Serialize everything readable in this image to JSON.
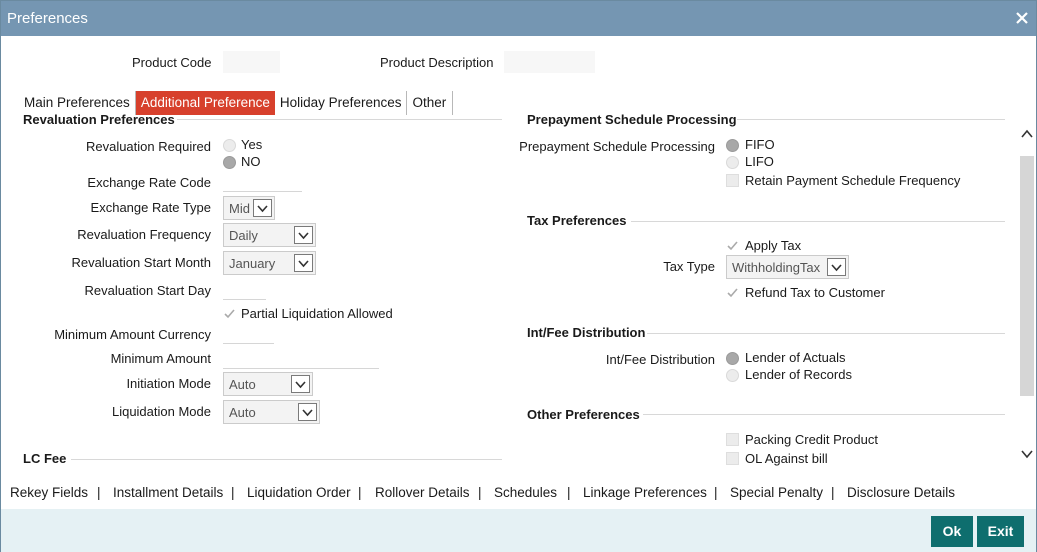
{
  "window": {
    "title": "Preferences"
  },
  "header": {
    "product_code_label": "Product Code",
    "product_code_value": "",
    "product_description_label": "Product Description",
    "product_description_value": ""
  },
  "tabs": [
    {
      "label": "Main Preferences"
    },
    {
      "label": "Additional Preference",
      "active": true
    },
    {
      "label": "Holiday Preferences"
    },
    {
      "label": "Other"
    }
  ],
  "revaluation": {
    "title": "Revaluation Preferences",
    "required_label": "Revaluation Required",
    "required_options": [
      "Yes",
      "NO"
    ],
    "required_selected": "NO",
    "exchange_rate_code_label": "Exchange Rate Code",
    "exchange_rate_code_value": "",
    "exchange_rate_type_label": "Exchange Rate Type",
    "exchange_rate_type_value": "Mid",
    "frequency_label": "Revaluation Frequency",
    "frequency_value": "Daily",
    "start_month_label": "Revaluation Start Month",
    "start_month_value": "January",
    "start_day_label": "Revaluation Start Day",
    "start_day_value": "",
    "partial_liq_label": "Partial Liquidation Allowed",
    "min_amount_currency_label": "Minimum Amount Currency",
    "min_amount_currency_value": "",
    "min_amount_label": "Minimum Amount",
    "min_amount_value": "",
    "initiation_mode_label": "Initiation Mode",
    "initiation_mode_value": "Auto",
    "liquidation_mode_label": "Liquidation Mode",
    "liquidation_mode_value": "Auto"
  },
  "lc_fee": {
    "title": "LC Fee"
  },
  "prepayment": {
    "title": "Prepayment Schedule Processing",
    "label": "Prepayment Schedule Processing",
    "options": [
      "FIFO",
      "LIFO"
    ],
    "selected": "FIFO",
    "retain_label": "Retain Payment Schedule Frequency"
  },
  "tax": {
    "title": "Tax Preferences",
    "apply_tax_label": "Apply Tax",
    "tax_type_label": "Tax Type",
    "tax_type_value": "WithholdingTax",
    "refund_label": "Refund Tax to Customer"
  },
  "distribution": {
    "title": "Int/Fee Distribution",
    "label": "Int/Fee Distribution",
    "options": [
      "Lender of Actuals",
      "Lender of Records"
    ],
    "selected": "Lender of Actuals"
  },
  "other": {
    "title": "Other Preferences",
    "packing_credit_label": "Packing Credit Product",
    "ol_against_bill_label": "OL Against bill"
  },
  "bottom_links": [
    "Rekey Fields",
    "Installment Details",
    "Liquidation Order",
    "Rollover Details",
    "Schedules",
    "Linkage Preferences",
    "Special Penalty",
    "Disclosure Details"
  ],
  "bottom_separator": "|",
  "footer": {
    "ok_label": "Ok",
    "exit_label": "Exit"
  },
  "colors": {
    "titlebar": "#7596b2",
    "active_tab": "#d7402c",
    "button": "#0e6e6e",
    "footer_bg": "#e5f1f4"
  }
}
